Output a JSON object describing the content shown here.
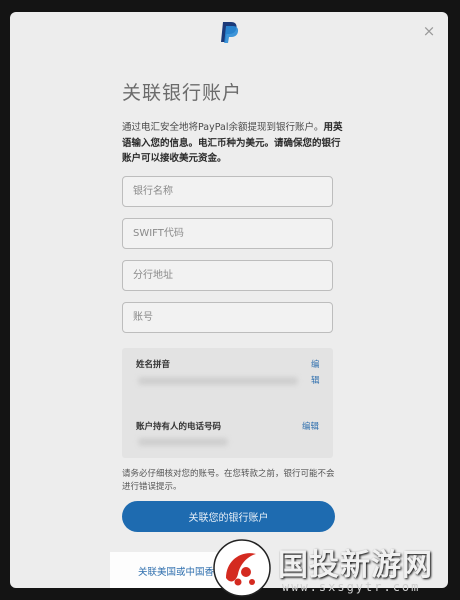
{
  "dialog": {
    "close_label": "×",
    "title": "关联银行账户",
    "desc_intro": "通过电汇安全地将PayPal余额提现到银行账户。",
    "desc_bold": "用英语输入您的信息。电汇币种为美元。请确保您的银行账户可以接收美元资金。"
  },
  "form": {
    "bank_name_placeholder": "银行名称",
    "swift_placeholder": "SWIFT代码",
    "branch_address_placeholder": "分行地址",
    "account_number_placeholder": "账号"
  },
  "info": {
    "name_label": "姓名拼音",
    "name_edit": "编",
    "name_edit_2": "辑",
    "phone_label": "账户持有人的电话号码",
    "phone_edit": "编辑"
  },
  "warning": "请务必仔细核对您的账号。在您转款之前，银行可能不会进行错误提示。",
  "primary_button": "关联您的银行账户",
  "secondary_link": "关联美国或中国香",
  "watermark": {
    "name": "国投新游网",
    "url": "www.sxsgytr.com"
  },
  "colors": {
    "brand_blue": "#1e6bb0",
    "link_blue": "#2f6fae",
    "paypal_dark": "#1b3a7a",
    "paypal_light": "#2a8bd6",
    "watermark_red": "#d42a20"
  },
  "icons": {
    "logo": "paypal-logo-icon",
    "close": "close-icon"
  }
}
